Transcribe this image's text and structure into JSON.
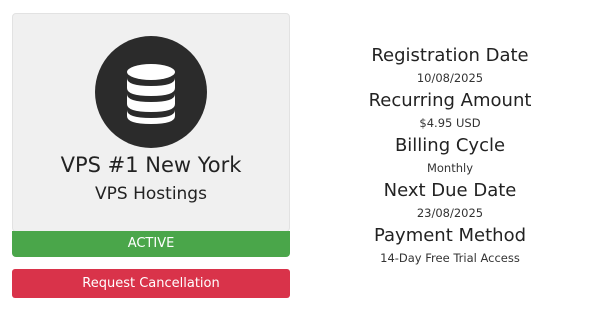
{
  "product": {
    "icon": "database-icon",
    "name": "VPS #1 New York",
    "group": "VPS Hostings",
    "status": "ACTIVE",
    "status_color": "#4aa64a"
  },
  "actions": {
    "cancel_label": "Request Cancellation",
    "cancel_color": "#d9334a"
  },
  "details": [
    {
      "label": "Registration Date",
      "value": "10/08/2025"
    },
    {
      "label": "Recurring Amount",
      "value": "$4.95 USD"
    },
    {
      "label": "Billing Cycle",
      "value": "Monthly"
    },
    {
      "label": "Next Due Date",
      "value": "23/08/2025"
    },
    {
      "label": "Payment Method",
      "value": "14-Day Free Trial Access"
    }
  ]
}
